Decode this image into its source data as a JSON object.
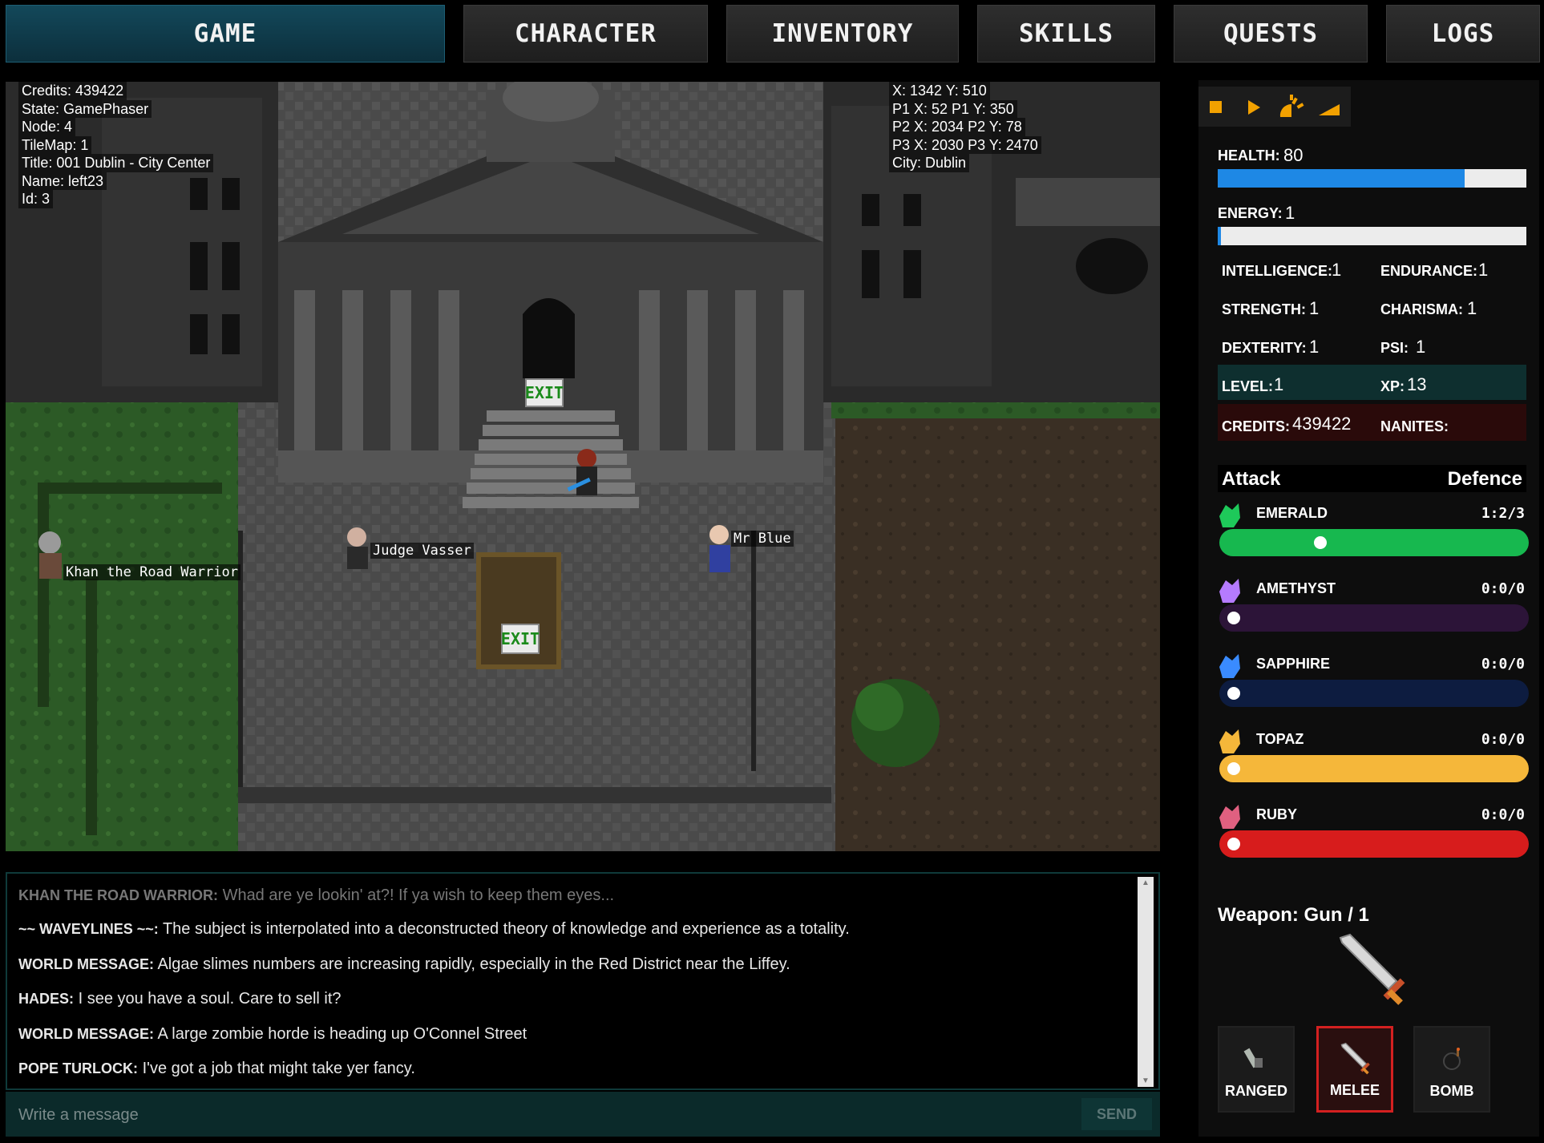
{
  "tabs": [
    {
      "label": "GAME",
      "active": true
    },
    {
      "label": "CHARACTER",
      "active": false
    },
    {
      "label": "INVENTORY",
      "active": false
    },
    {
      "label": "SKILLS",
      "active": false
    },
    {
      "label": "QUESTS",
      "active": false
    },
    {
      "label": "LOGS",
      "active": false
    }
  ],
  "debug_left": {
    "credits": "Credits: 439422",
    "state": "State: GamePhaser",
    "node": "Node: 4",
    "tilemap": "TileMap: 1",
    "title": "Title: 001 Dublin - City Center",
    "name": "Name: left23",
    "id": "Id: 3"
  },
  "debug_right": {
    "pos": "X: 1342 Y: 510",
    "p1": "P1 X: 52 P1 Y: 350",
    "p2": "P2 X: 2034 P2 Y: 78",
    "p3": "P3 X: 2030 P3 Y: 2470",
    "city": "City: Dublin"
  },
  "npcs": {
    "khan": "Khan the Road Warrior",
    "judge": "Judge Vasser",
    "mrblue": "Mr Blue"
  },
  "signs": {
    "exit_top": "EXIT",
    "exit_bottom": "EXIT"
  },
  "chat": {
    "messages": [
      {
        "speaker": "KHAN THE ROAD WARRIOR:",
        "text": "Whad are ye lookin' at?! If ya wish to keep them eyes..."
      },
      {
        "speaker": "~~ WAVEYLINES ~~:",
        "text": "The subject is interpolated into a deconstructed theory of knowledge and experience as a totality."
      },
      {
        "speaker": "WORLD MESSAGE:",
        "text": "Algae slimes numbers are increasing rapidly, especially in the Red District near the Liffey."
      },
      {
        "speaker": "HADES:",
        "text": "I see you have a soul. Care to sell it?"
      },
      {
        "speaker": "WORLD MESSAGE:",
        "text": "A large zombie horde is heading up O'Connel Street"
      },
      {
        "speaker": "POPE TURLOCK:",
        "text": "I've got a job that might take yer fancy."
      }
    ],
    "input_placeholder": "Write a message",
    "send_label": "SEND"
  },
  "controls": [
    "stop-icon",
    "play-icon",
    "fast-icon",
    "volume-icon"
  ],
  "stats": {
    "health_label": "HEALTH:",
    "health": "80",
    "health_pct": 80,
    "energy_label": "ENERGY:",
    "energy": "1",
    "energy_pct": 1,
    "intelligence_label": "INTELLIGENCE:",
    "intelligence": "1",
    "endurance_label": "ENDURANCE:",
    "endurance": "1",
    "strength_label": "STRENGTH:",
    "strength": "1",
    "charisma_label": "CHARISMA:",
    "charisma": "1",
    "dexterity_label": "DEXTERITY:",
    "dexterity": "1",
    "psi_label": "PSI:",
    "psi": "1",
    "level_label": "LEVEL:",
    "level": "1",
    "xp_label": "XP:",
    "xp": "13",
    "credits_label": "CREDITS:",
    "credits": "439422",
    "nanites_label": "NANITES:"
  },
  "gems_header": {
    "attack": "Attack",
    "defence": "Defence"
  },
  "gems": [
    {
      "name": "EMERALD",
      "ratio": "1:2/3",
      "color": "#1ec95a",
      "track": "#17b84f",
      "level": 0.3
    },
    {
      "name": "AMETHYST",
      "ratio": "0:0/0",
      "color": "#b57bff",
      "track": "#2c1438",
      "level": 0
    },
    {
      "name": "SAPPHIRE",
      "ratio": "0:0/0",
      "color": "#3a8bff",
      "track": "#0d1c40",
      "level": 0
    },
    {
      "name": "TOPAZ",
      "ratio": "0:0/0",
      "color": "#f5b73a",
      "track": "#f5b73a",
      "level": 0
    },
    {
      "name": "RUBY",
      "ratio": "0:0/0",
      "color": "#e06080",
      "track": "#d71c1c",
      "level": 0
    }
  ],
  "weapon": {
    "label": "Weapon: Gun / 1",
    "buttons": [
      {
        "label": "RANGED",
        "selected": false
      },
      {
        "label": "MELEE",
        "selected": true
      },
      {
        "label": "BOMB",
        "selected": false
      }
    ]
  }
}
